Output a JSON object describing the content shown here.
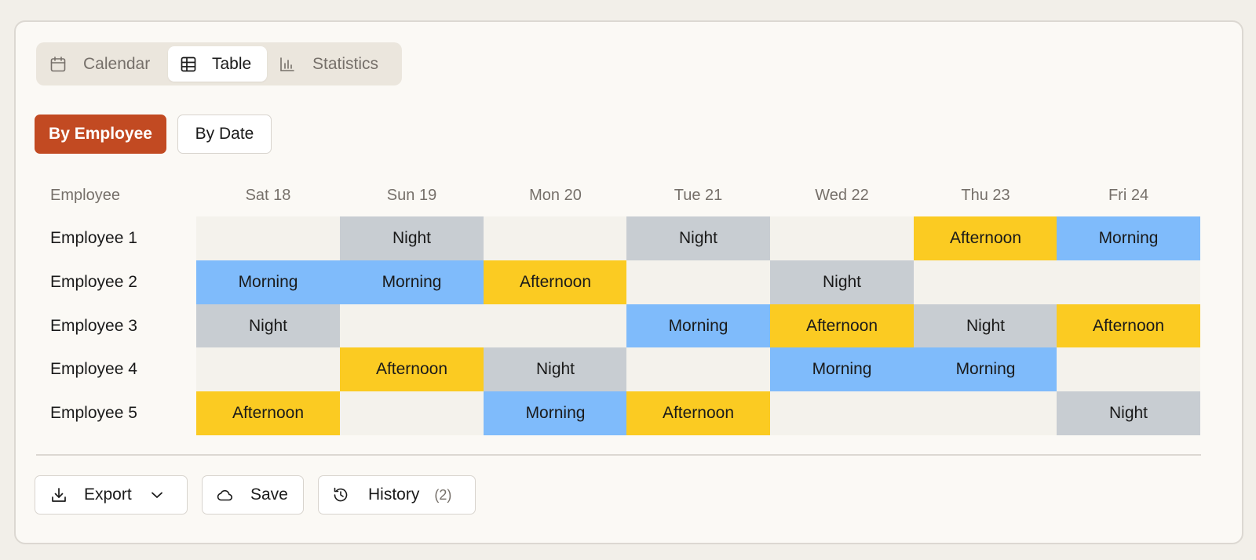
{
  "view_tabs": {
    "calendar_label": "Calendar",
    "table_label": "Table",
    "statistics_label": "Statistics",
    "active": "Table"
  },
  "group_by": {
    "by_employee_label": "By Employee",
    "by_date_label": "By Date",
    "active": "By Employee"
  },
  "table": {
    "first_header": "Employee",
    "days": [
      "Sat 18",
      "Sun 19",
      "Mon 20",
      "Tue 21",
      "Wed 22",
      "Thu 23",
      "Fri 24"
    ],
    "rows": [
      {
        "employee": "Employee 1",
        "shifts": [
          "",
          "Night",
          "",
          "Night",
          "",
          "Afternoon",
          "Morning"
        ]
      },
      {
        "employee": "Employee 2",
        "shifts": [
          "Morning",
          "Morning",
          "Afternoon",
          "",
          "Night",
          "",
          ""
        ]
      },
      {
        "employee": "Employee 3",
        "shifts": [
          "Night",
          "",
          "",
          "Morning",
          "Afternoon",
          "Night",
          "Afternoon"
        ]
      },
      {
        "employee": "Employee 4",
        "shifts": [
          "",
          "Afternoon",
          "Night",
          "",
          "Morning",
          "Morning",
          ""
        ]
      },
      {
        "employee": "Employee 5",
        "shifts": [
          "Afternoon",
          "",
          "Morning",
          "Afternoon",
          "",
          "",
          "Night"
        ]
      }
    ]
  },
  "shift_colors": {
    "Morning": "#7fbbfb",
    "Afternoon": "#fbcb22",
    "Night": "#c8cdd2",
    "empty": "#f4f2ec"
  },
  "footer": {
    "export_label": "Export",
    "save_label": "Save",
    "history_label": "History",
    "history_count": "(2)"
  },
  "colors": {
    "accent": "#c24a22"
  }
}
